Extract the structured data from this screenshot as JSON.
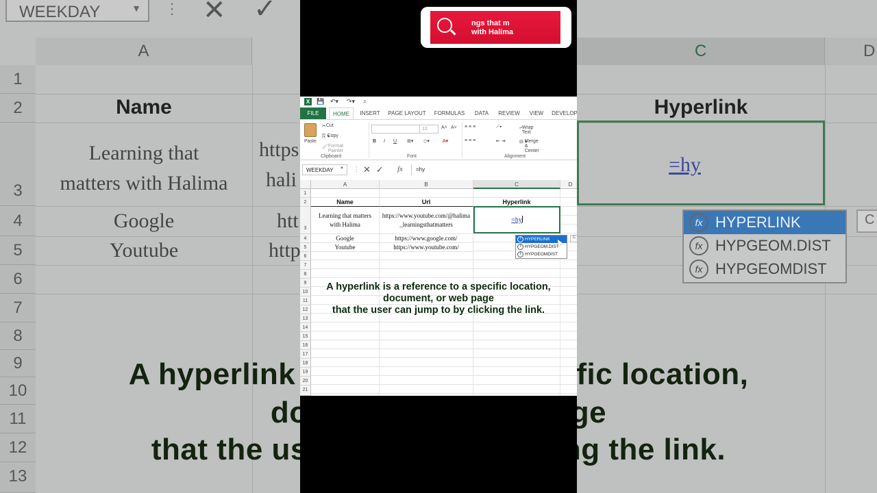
{
  "search": {
    "text_line1": "ngs that m",
    "text_line2": "with Halima"
  },
  "excel": {
    "tabs": [
      "FILE",
      "HOME",
      "INSERT",
      "PAGE LAYOUT",
      "FORMULAS",
      "DATA",
      "REVIEW",
      "VIEW",
      "DEVELOP"
    ],
    "clipboard": {
      "paste": "Paste",
      "cut": "Cut",
      "copy": "Copy",
      "format_painter": "Format Painter",
      "group": "Clipboard"
    },
    "font": {
      "size": "12",
      "bold": "B",
      "italic": "I",
      "underline": "U",
      "group": "Font"
    },
    "alignment": {
      "wrap_text": "Wrap Text",
      "merge_center": "Merge & Center",
      "group": "Alignment"
    },
    "name_box": "WEEKDAY",
    "formula_bar": {
      "fx": "fx",
      "value": "=hy"
    },
    "columns": [
      "A",
      "B",
      "C",
      "D"
    ],
    "rows": [
      "1",
      "2",
      "3",
      "4",
      "5",
      "6",
      "7",
      "8",
      "9",
      "10",
      "11",
      "12",
      "13",
      "14",
      "15",
      "16",
      "17",
      "18",
      "19",
      "20",
      "21"
    ],
    "headers": {
      "name": "Name",
      "url": "Url",
      "hyperlink": "Hyperlink"
    },
    "data": [
      {
        "name": "Learning that matters with Halima",
        "url": "https://www.youtube.com/@halima_learningsthatmatters"
      },
      {
        "name": "Google",
        "url": "https://www.google.com/"
      },
      {
        "name": "Youtube",
        "url": "https://www.youtube.com/"
      }
    ],
    "active_cell_value": "=hy",
    "autocomplete": [
      "HYPERLINK",
      "HYPGEOM.DIST",
      "HYPGEOMDIST"
    ]
  },
  "caption": {
    "line1": "A hyperlink is a reference to a specific location,",
    "line2": "document, or web page",
    "line3": "that the user can jump to by clicking the link."
  },
  "background": {
    "name_box": "WEEKDAY",
    "col_a": "A",
    "col_c": "C",
    "col_d": "D",
    "rows": [
      "1",
      "2",
      "3",
      "4",
      "5",
      "6",
      "7",
      "8",
      "9",
      "10",
      "11",
      "12",
      "13"
    ],
    "header_name": "Name",
    "header_hyperlink": "Hyperlink",
    "url_partial_1": "https",
    "url_partial_2": "hali",
    "url_partial_3": "htt",
    "url_partial_4": "http",
    "name_line1": "Learning that",
    "name_line2": "matters with Halima",
    "google": "Google",
    "youtube": "Youtube",
    "formula": "=hy",
    "ac": [
      "HYPERLINK",
      "HYPGEOM.DIST",
      "HYPGEOMDIST"
    ],
    "ac_tip": "C",
    "caption_line1": "A hyperlink is a r                  ecific location,",
    "caption_line2": "docu                          ge",
    "caption_line3": "that the user ca                  king the link."
  },
  "colors": {
    "excel_green": "#217346",
    "search_red": "#e8183c",
    "ac_select": "#1c6fd0"
  }
}
